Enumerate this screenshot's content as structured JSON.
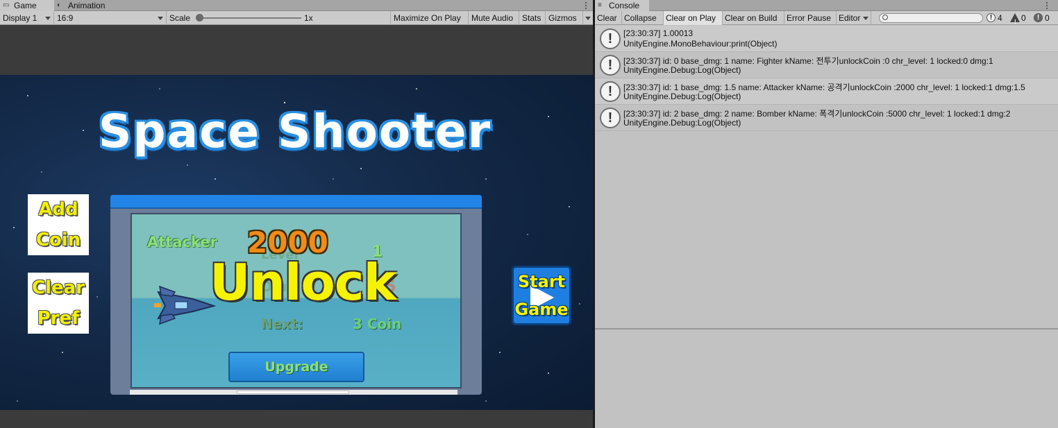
{
  "game": {
    "tabs": [
      {
        "label": "Game",
        "icon": "gamepad-icon"
      },
      {
        "label": "Animation",
        "icon": "animation-icon"
      }
    ],
    "toolbar": {
      "display": "Display 1",
      "aspect": "16:9",
      "scale_label": "Scale",
      "scale_value": "1x",
      "scale_fraction": 0.0,
      "maximize": "Maximize On Play",
      "mute": "Mute Audio",
      "stats": "Stats",
      "gizmos": "Gizmos"
    },
    "scene": {
      "title": "Space Shooter",
      "add_coin": [
        "Add",
        "Coin"
      ],
      "clear_pref": [
        "Clear",
        "Pref"
      ],
      "start_game": [
        "Start",
        "Game"
      ],
      "card": {
        "char_name": "Attacker",
        "coins": "2000",
        "level_label": "Level",
        "level_value": "1",
        "dmg_label": "Dmg",
        "dmg_value": "1.5",
        "unlock": "Unlock",
        "next_label": "Next:",
        "next_value": "3 Coin",
        "upgrade": "Upgrade"
      }
    }
  },
  "console": {
    "tab": {
      "label": "Console",
      "icon": "console-icon"
    },
    "toolbar": {
      "clear": "Clear",
      "collapse": "Collapse",
      "clear_on_play": "Clear on Play",
      "clear_on_build": "Clear on Build",
      "error_pause": "Error Pause",
      "editor": "Editor",
      "search_placeholder": "",
      "log_count": "4",
      "warn_count": "0",
      "error_count": "0"
    },
    "logs": [
      {
        "line1": "[23:30:37] 1.00013",
        "line2": "UnityEngine.MonoBehaviour:print(Object)"
      },
      {
        "line1": "[23:30:37]  id: 0 base_dmg: 1 name: Fighter kName: 전투기unlockCoin :0 chr_level: 1 locked:0 dmg:1",
        "line2": "UnityEngine.Debug:Log(Object)"
      },
      {
        "line1": "[23:30:37]  id: 1 base_dmg: 1.5 name: Attacker kName: 공격기unlockCoin :2000 chr_level: 1 locked:1 dmg:1.5",
        "line2": "UnityEngine.Debug:Log(Object)"
      },
      {
        "line1": "[23:30:37]  id: 2 base_dmg: 2 name: Bomber kName: 폭격기unlockCoin :5000 chr_level: 1 locked:1 dmg:2",
        "line2": "UnityEngine.Debug:Log(Object)"
      }
    ]
  }
}
